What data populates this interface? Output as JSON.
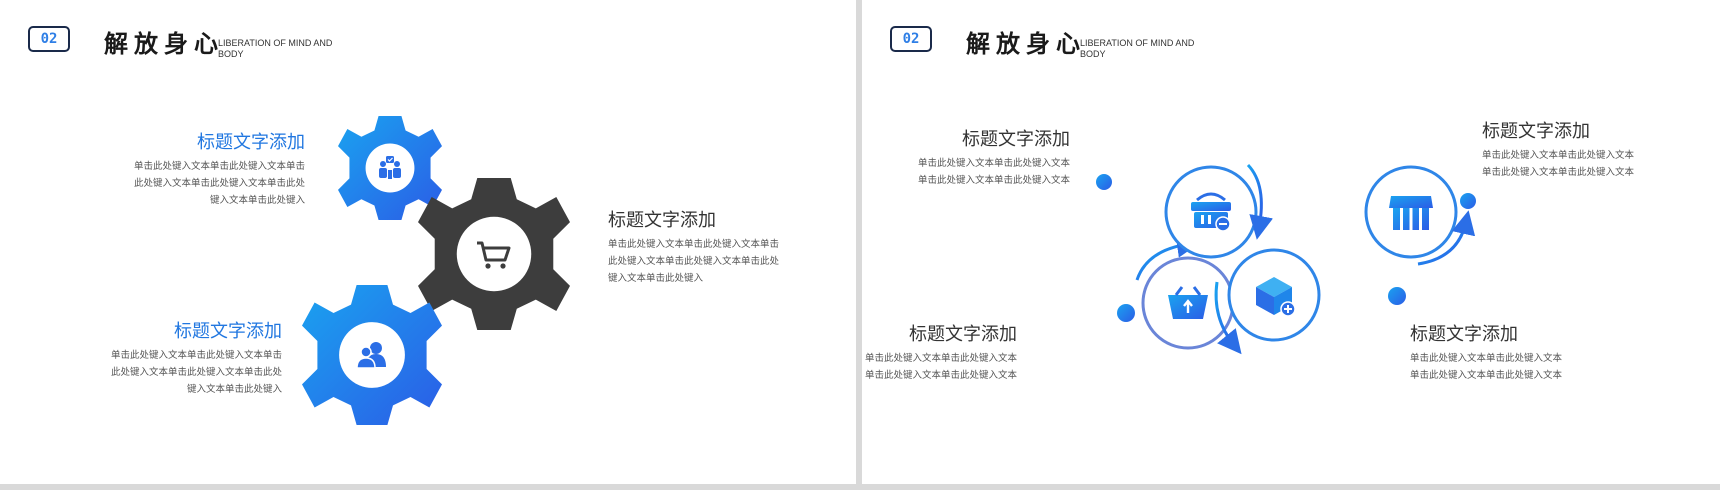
{
  "header": {
    "badge": "02",
    "title": "解放身心",
    "subtitle": "LIBERATION OF MIND AND BODY"
  },
  "left_slide": {
    "blocks": [
      {
        "title": "标题文字添加",
        "body_lines": [
          "单击此处键入文本单击此处键入文本单击",
          "此处键入文本单击此处键入文本单击此处",
          "键入文本单击此处键入"
        ]
      },
      {
        "title": "标题文字添加",
        "body_lines": [
          "单击此处键入文本单击此处键入文本单击",
          "此处键入文本单击此处键入文本单击此处",
          "键入文本单击此处键入"
        ]
      },
      {
        "title": "标题文字添加",
        "body_lines": [
          "单击此处键入文本单击此处键入文本单击",
          "此处键入文本单击此处键入文本单击此处",
          "键入文本单击此处键入"
        ]
      }
    ],
    "gears": [
      {
        "icon": "team-check-icon",
        "color": "blue-gradient"
      },
      {
        "icon": "cart-icon",
        "color": "#3d3d3d"
      },
      {
        "icon": "users-icon",
        "color": "blue-gradient"
      }
    ]
  },
  "right_slide": {
    "blocks": [
      {
        "title": "标题文字添加",
        "body_lines": [
          "单击此处键入文本单击此处键入文本",
          "单击此处键入文本单击此处键入文本"
        ]
      },
      {
        "title": "标题文字添加",
        "body_lines": [
          "单击此处键入文本单击此处键入文本",
          "单击此处键入文本单击此处键入文本"
        ]
      },
      {
        "title": "标题文字添加",
        "body_lines": [
          "单击此处键入文本单击此处键入文本",
          "单击此处键入文本单击此处键入文本"
        ]
      },
      {
        "title": "标题文字添加",
        "body_lines": [
          "单击此处键入文本单击此处键入文本",
          "单击此处键入文本单击此处键入文本"
        ]
      }
    ],
    "circles": [
      {
        "icon": "basket-upload-icon"
      },
      {
        "icon": "shop-basket-icon"
      },
      {
        "icon": "box-add-icon"
      },
      {
        "icon": "store-icon"
      }
    ]
  },
  "colors": {
    "accent_blue": "#2177e0",
    "gradient_start": "#1aa3f0",
    "gradient_end": "#2b5ce6",
    "gear_dark": "#3d3d3d"
  }
}
